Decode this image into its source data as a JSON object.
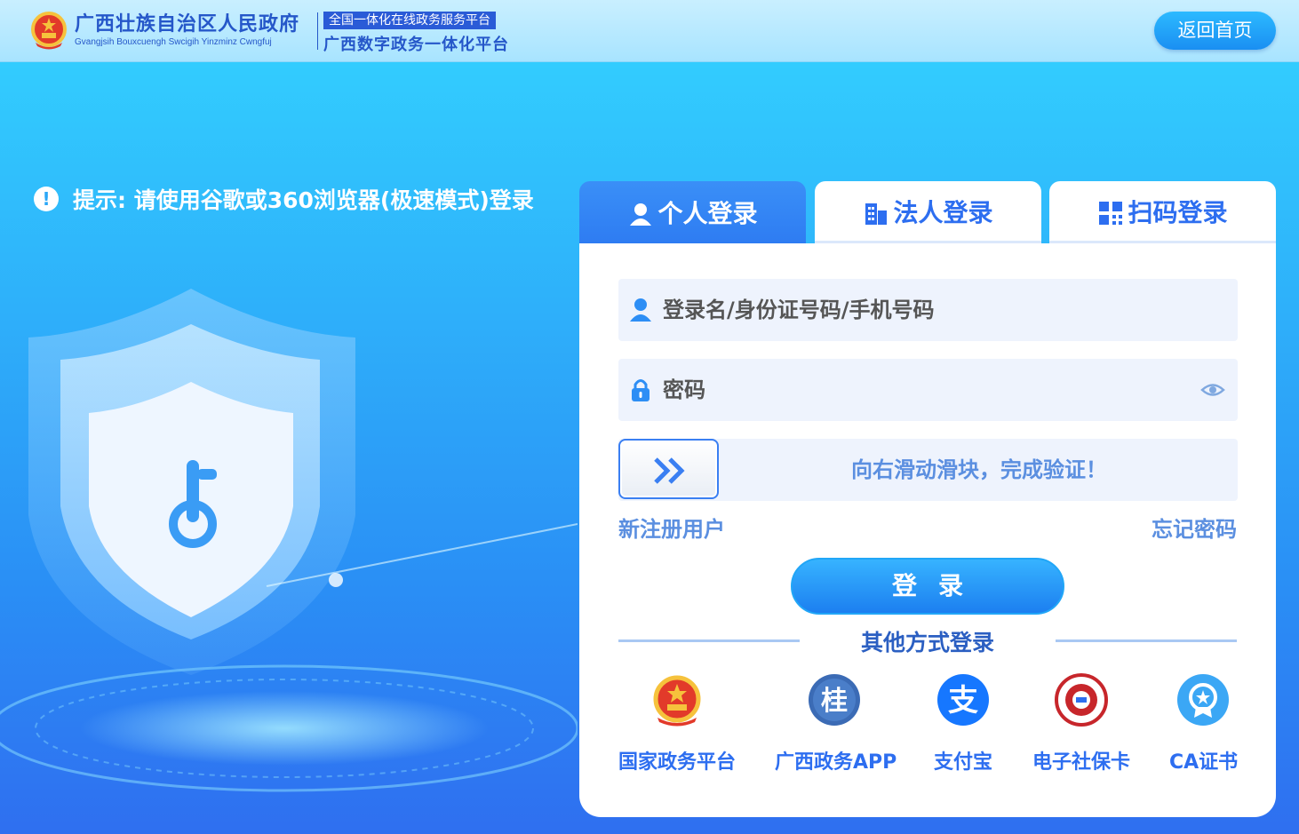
{
  "header": {
    "gov_name_cn": "广西壮族自治区人民政府",
    "gov_name_en": "Gvangjsih Bouxcuengh Swcigih Yinzminz Cwngfuj",
    "platform_tag": "全国一体化在线政务服务平台",
    "platform_name": "广西数字政务一体化平台",
    "home_button": "返回首页"
  },
  "tip": {
    "icon": "!",
    "text": "提示: 请使用谷歌或360浏览器(极速模式)登录"
  },
  "tabs": [
    {
      "label": "个人登录",
      "icon": "person-icon",
      "active": true
    },
    {
      "label": "法人登录",
      "icon": "building-icon",
      "active": false
    },
    {
      "label": "扫码登录",
      "icon": "qr-code-icon",
      "active": false
    }
  ],
  "form": {
    "username_placeholder": "登录名/身份证号码/手机号码",
    "password_placeholder": "密码",
    "slider_text": "向右滑动滑块，完成验证！",
    "register_link": "新注册用户",
    "forgot_link": "忘记密码",
    "login_button": "登录"
  },
  "other_login": {
    "title": "其他方式登录",
    "options": [
      {
        "label": "国家政务平台",
        "icon": "national-emblem-icon"
      },
      {
        "label": "广西政务APP",
        "icon": "guangxi-app-icon"
      },
      {
        "label": "支付宝",
        "icon": "alipay-icon"
      },
      {
        "label": "电子社保卡",
        "icon": "social-security-card-icon"
      },
      {
        "label": "CA证书",
        "icon": "ca-certificate-icon"
      }
    ]
  },
  "colors": {
    "accent": "#2d6ef0",
    "header_bg": "#b8e9ff",
    "page_bg_top": "#33d3ff",
    "page_bg_bottom": "#2f6ff0"
  }
}
